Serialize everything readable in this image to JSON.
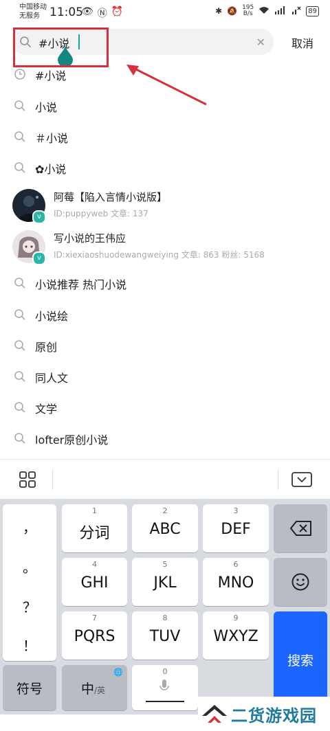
{
  "status_bar": {
    "carrier_line1": "中国移动",
    "carrier_line2": "无服务",
    "time": "11:05",
    "net_speed_value": "195",
    "net_speed_unit": "B/s",
    "battery": "89"
  },
  "search": {
    "query": "#小说",
    "cancel_label": "取消"
  },
  "suggestions_top": [
    {
      "text": "#小说",
      "icon": "history-clock-icon"
    },
    {
      "text": "小说",
      "icon": "search-icon"
    },
    {
      "text": "＃小说",
      "icon": "search-icon"
    },
    {
      "text": "✿小说",
      "icon": "search-icon"
    }
  ],
  "users": [
    {
      "name": "阿莓【陷入言情小说版】",
      "meta": "ID:puppyweb   文章: 137"
    },
    {
      "name": "写小说的王伟应",
      "meta": "ID:xiexiaoshuodewangweiying   文章: 863   粉丝: 5168"
    }
  ],
  "suggestions_bottom": [
    {
      "text": "小说推荐 热门小说"
    },
    {
      "text": "小说绘"
    },
    {
      "text": "原创"
    },
    {
      "text": "同人文"
    },
    {
      "text": "文学"
    },
    {
      "text": "lofter原创小说"
    }
  ],
  "keyboard": {
    "punct": [
      "，",
      "。",
      "？",
      "！"
    ],
    "keys": [
      {
        "num": "1",
        "label": "分词"
      },
      {
        "num": "2",
        "label": "ABC"
      },
      {
        "num": "3",
        "label": "DEF"
      },
      {
        "num": "4",
        "label": "GHI"
      },
      {
        "num": "5",
        "label": "JKL"
      },
      {
        "num": "6",
        "label": "MNO"
      },
      {
        "num": "7",
        "label": "PQRS"
      },
      {
        "num": "8",
        "label": "TUV"
      },
      {
        "num": "9",
        "label": "WXYZ"
      }
    ],
    "symbols_label": "符号",
    "lang_main": "中",
    "lang_alt": "/英",
    "space_num": "0",
    "search_label": "搜索"
  },
  "watermark": "二货游戏园",
  "colors": {
    "accent_teal": "#1aa39a",
    "annotation_red": "#d6303a",
    "search_key_blue": "#1a66ff"
  }
}
